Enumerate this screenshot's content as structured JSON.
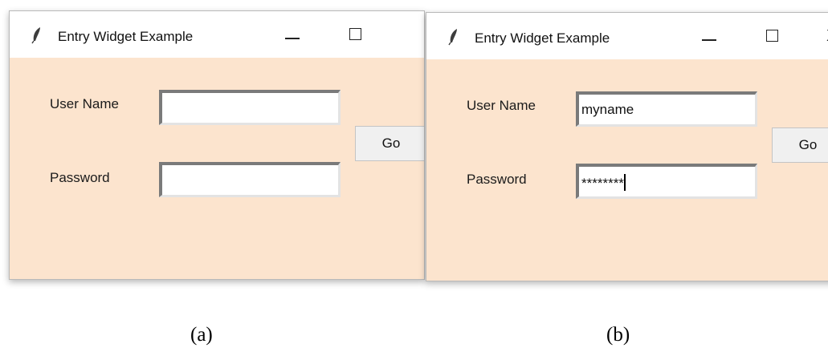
{
  "panels": [
    {
      "title": "Entry Widget Example",
      "username_label": "User Name",
      "password_label": "Password",
      "username_value": "",
      "password_value": "",
      "go_label": "Go",
      "caption": "(a)"
    },
    {
      "title": "Entry Widget Example",
      "username_label": "User Name",
      "password_label": "Password",
      "username_value": "myname",
      "password_value": "********",
      "go_label": "Go",
      "caption": "(b)"
    }
  ],
  "window_controls": {
    "close_glyph": "X"
  },
  "colors": {
    "window_background": "#fce4ce",
    "titlebar": "#ffffff",
    "button_face": "#f0f0f0"
  },
  "icons": [
    "feather-icon",
    "minimize-icon",
    "maximize-icon",
    "close-icon"
  ]
}
